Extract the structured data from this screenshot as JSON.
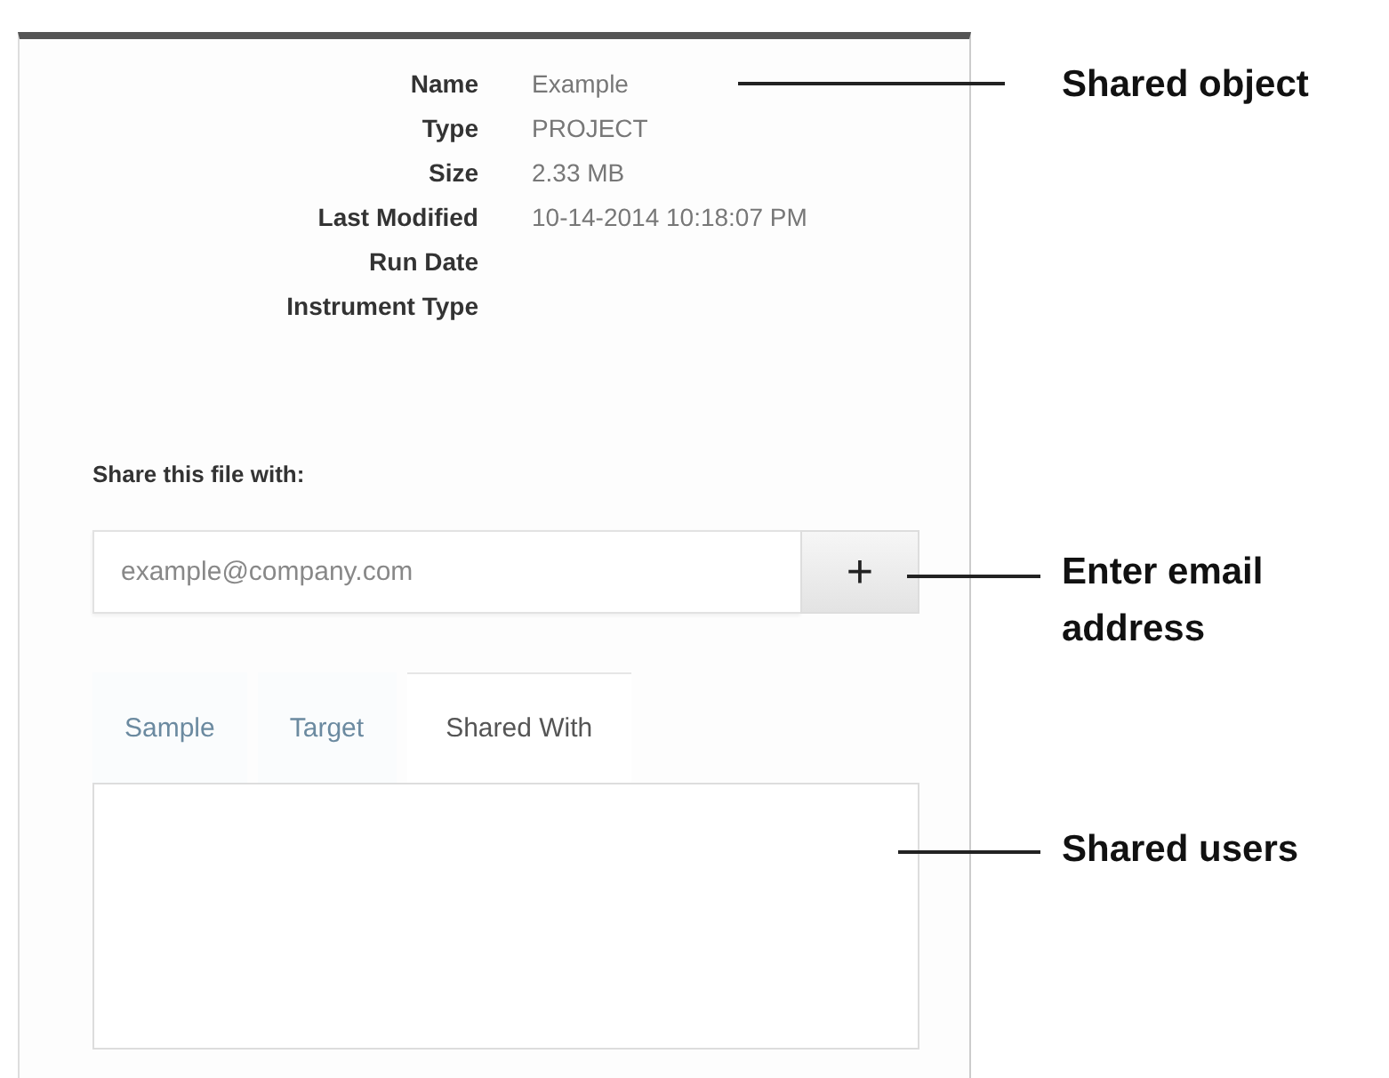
{
  "properties": [
    {
      "label": "Name",
      "value": "Example"
    },
    {
      "label": "Type",
      "value": "PROJECT"
    },
    {
      "label": "Size",
      "value": "2.33 MB"
    },
    {
      "label": "Last Modified",
      "value": "10-14-2014 10:18:07 PM"
    },
    {
      "label": "Run Date"
    },
    {
      "label": "Instrument Type"
    }
  ],
  "share": {
    "heading": "Share this file with:",
    "placeholder": "example@company.com",
    "add_button": "+"
  },
  "tabs": [
    {
      "label": "Sample",
      "selected": false
    },
    {
      "label": "Target",
      "selected": false
    },
    {
      "label": "Shared With",
      "selected": true
    }
  ],
  "callouts": [
    "Shared object",
    "Enter email address",
    "Shared users"
  ]
}
